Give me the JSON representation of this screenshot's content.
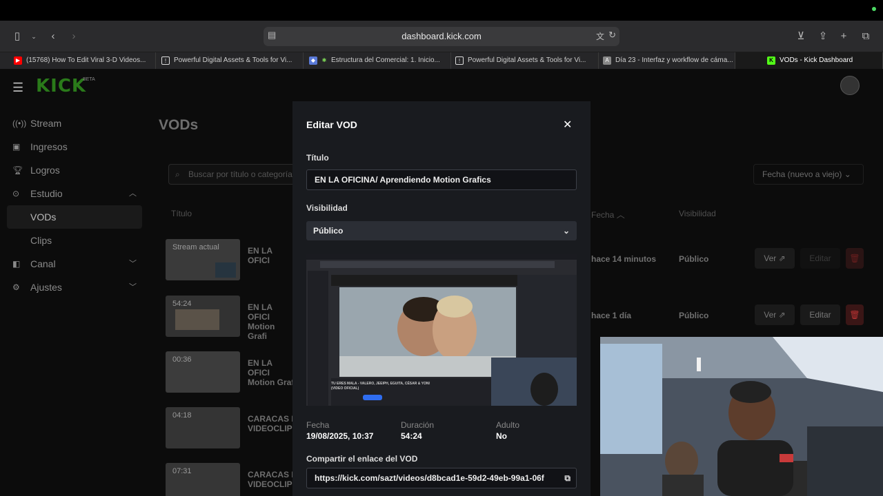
{
  "browser": {
    "url": "dashboard.kick.com",
    "tabs": [
      {
        "label": "(15768) How To Edit Viral 3-D Videos..."
      },
      {
        "label": "Powerful Digital Assets & Tools for Vi..."
      },
      {
        "label": "Estructura del Comercial: 1. Inicio..."
      },
      {
        "label": "Powerful Digital Assets & Tools for Vi..."
      },
      {
        "label": "Día 23 - Interfaz y workflow de cáma..."
      },
      {
        "label": "VODs - Kick Dashboard"
      }
    ]
  },
  "header": {
    "logo": "KICK",
    "beta": "BETA"
  },
  "sidebar": {
    "items": [
      {
        "label": "Stream",
        "icon": "broadcast-icon"
      },
      {
        "label": "Ingresos",
        "icon": "wallet-icon"
      },
      {
        "label": "Logros",
        "icon": "trophy-icon"
      },
      {
        "label": "Estudio",
        "icon": "studio-icon"
      },
      {
        "label": "VODs"
      },
      {
        "label": "Clips"
      },
      {
        "label": "Canal",
        "icon": "channel-icon"
      },
      {
        "label": "Ajustes",
        "icon": "gear-icon"
      }
    ]
  },
  "main": {
    "title": "VODs",
    "search_placeholder": "Buscar por título o categoría",
    "sort_label": "Fecha (nuevo a viejo)",
    "columns": {
      "title": "Título",
      "date": "Fecha",
      "visibility": "Visibilidad"
    },
    "rows": [
      {
        "thumb_label": "Stream actual",
        "title": "EN LA OFICI",
        "date": "hace 14 minutos",
        "visibility": "Público",
        "view": "Ver",
        "edit": "Editar"
      },
      {
        "thumb_label": "54:24",
        "title": "EN LA OFICI Motion Grafi",
        "date": "hace 1 día",
        "visibility": "Público",
        "view": "Ver",
        "edit": "Editar"
      },
      {
        "thumb_label": "00:36",
        "title": "EN LA OFICI Motion Graf"
      },
      {
        "thumb_label": "04:18",
        "title": "CARACAS I VIDEOCLIP"
      },
      {
        "thumb_label": "07:31",
        "title": "CARACAS I VIDEOCLIP"
      }
    ]
  },
  "modal": {
    "title": "Editar VOD",
    "title_label": "Título",
    "title_value": "EN LA OFICINA/ Aprendiendo Motion Grafics",
    "visibility_label": "Visibilidad",
    "visibility_value": "Público",
    "preview_caption": "TU ERES MALA - VALERO, JEEIPH, EGUITA, CÉSAR & YONI (VIDEO OFICIAL)",
    "date_label": "Fecha",
    "date_value": "19/08/2025, 10:37",
    "duration_label": "Duración",
    "duration_value": "54:24",
    "adult_label": "Adulto",
    "adult_value": "No",
    "share_label": "Compartir el enlace del VOD",
    "share_url": "https://kick.com/sazt/videos/d8bcad1e-59d2-49eb-99a1-06f"
  },
  "colors": {
    "kick_green": "#53fc18",
    "delete_red": "#e5484d"
  }
}
